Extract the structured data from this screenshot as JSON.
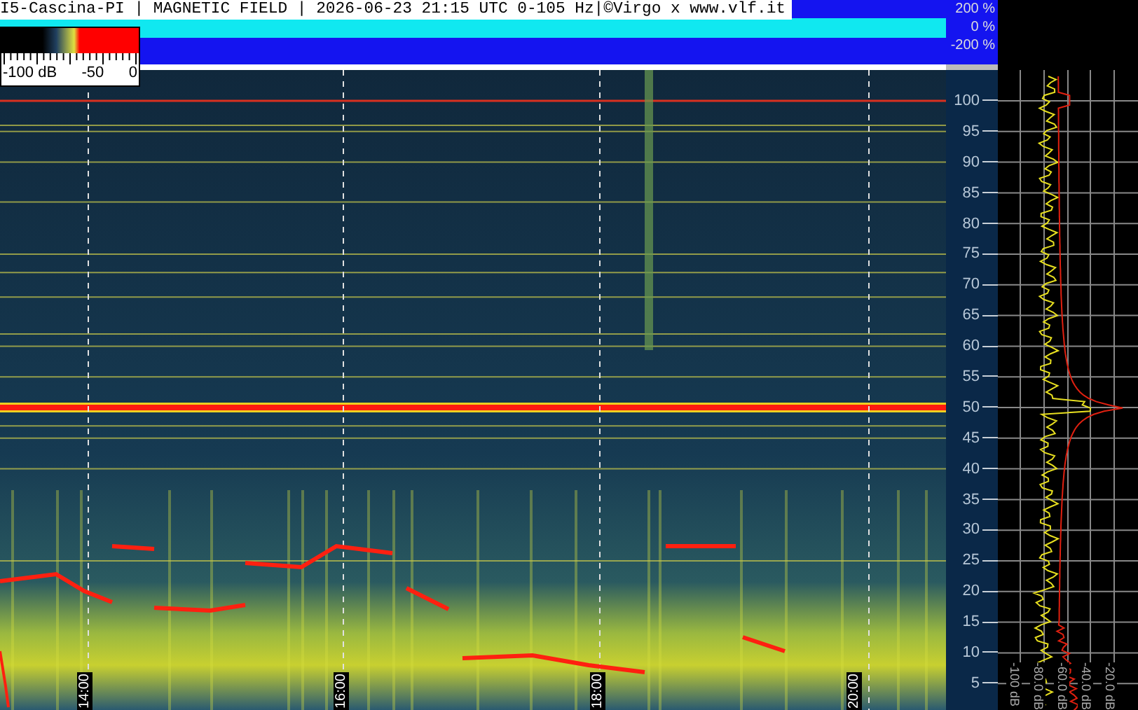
{
  "header": {
    "title": "I5-Cascina-PI | MAGNETIC FIELD | 2026-06-23 21:15 UTC 0-105 Hz|©Virgo x www.vlf.it"
  },
  "amplitude_strip": {
    "scale_labels": [
      "200 %",
      "0 %",
      "-200 %"
    ]
  },
  "color_legend": {
    "labels": [
      "-100 dB",
      "-50",
      "0"
    ]
  },
  "frequency_axis": {
    "labels": [
      "100",
      "95",
      "90",
      "85",
      "80",
      "75",
      "70",
      "65",
      "60",
      "55",
      "50",
      "45",
      "40",
      "35",
      "30",
      "25",
      "20",
      "15",
      "10",
      "5"
    ]
  },
  "time_axis": {
    "labels": [
      "14:00",
      "16:00",
      "18:00",
      "20:00"
    ]
  },
  "spectrum_panel": {
    "db_labels": [
      "-100 dB",
      "-80.0 dB",
      "-60.0 dB",
      "-40.0 dB",
      "-20.0 dB"
    ]
  }
}
